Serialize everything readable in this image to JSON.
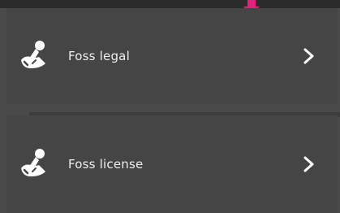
{
  "header": {
    "pointer_icon": "pink-down-arrow-icon",
    "pointer_color": "#e2237c"
  },
  "list": {
    "items": [
      {
        "label": "Foss legal",
        "icon": "user-desk-icon",
        "chevron": "chevron-right-icon"
      },
      {
        "label": "Foss license",
        "icon": "user-desk-icon",
        "chevron": "chevron-right-icon"
      }
    ]
  },
  "colors": {
    "background": "#4a4a4a",
    "item_background": "#454545",
    "text": "#f0f0f0",
    "top_bar": "#2b2b2b"
  }
}
